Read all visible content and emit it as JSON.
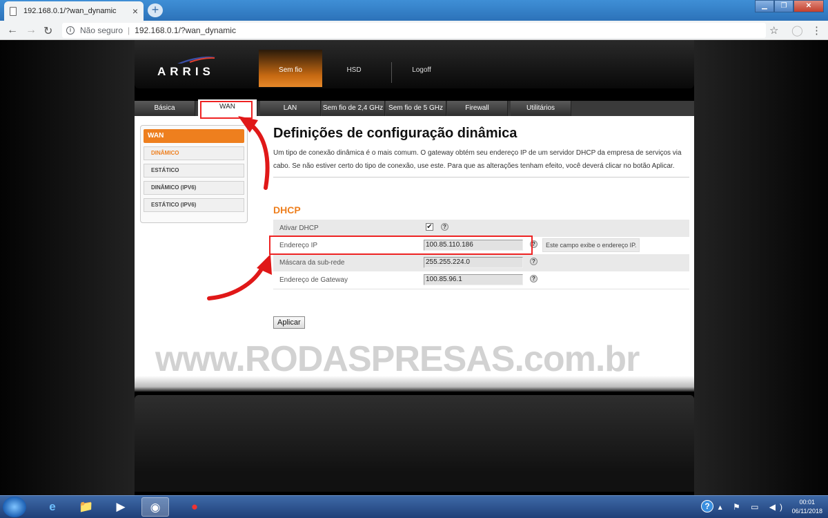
{
  "browser": {
    "tab_title": "192.168.0.1/?wan_dynamic",
    "tab_close": "×",
    "new_tab": "+",
    "security_label": "Não seguro",
    "url": "192.168.0.1/?wan_dynamic",
    "separator": "|"
  },
  "router": {
    "brand": "ARRIS",
    "top_nav": [
      "Sem fio",
      "HSD",
      "Logoff"
    ],
    "tabs": [
      "Básica",
      "WAN",
      "LAN",
      "Sem fio de 2,4 GHz",
      "Sem fio de 5 GHz",
      "Firewall",
      "Utilitários"
    ],
    "sidebar": {
      "title": "WAN",
      "items": [
        "DINÂMICO",
        "ESTÁTICO",
        "DINÂMICO (IPV6)",
        "ESTÁTICO (IPV6)"
      ]
    },
    "title": "Definições de configuração dinâmica",
    "description": "Um tipo de conexão dinâmica é o mais comum. O gateway obtém seu endereço IP de um servidor DHCP da empresa de serviços via cabo. Se não estiver certo do tipo de conexão, use este. Para que as alterações tenham efeito, você deverá clicar no botão Aplicar.",
    "section": "DHCP",
    "fields": {
      "enable_dhcp_label": "Ativar DHCP",
      "enable_dhcp_checked": "✔",
      "ip_label": "Endereço IP",
      "ip_value": "100.85.110.186",
      "ip_tip": "Este campo exibe o endereço IP.",
      "mask_label": "Máscara da sub-rede",
      "mask_value": "255.255.224.0",
      "gateway_label": "Endereço de Gateway",
      "gateway_value": "100.85.96.1",
      "help": "?"
    },
    "apply_label": "Aplicar"
  },
  "watermark": "www.RODASPRESAS.com.br",
  "taskbar": {
    "time": "00:01",
    "date": "06/11/2018",
    "help": "?"
  },
  "colors": {
    "accent": "#ee7f1e",
    "highlight": "#e22222"
  }
}
